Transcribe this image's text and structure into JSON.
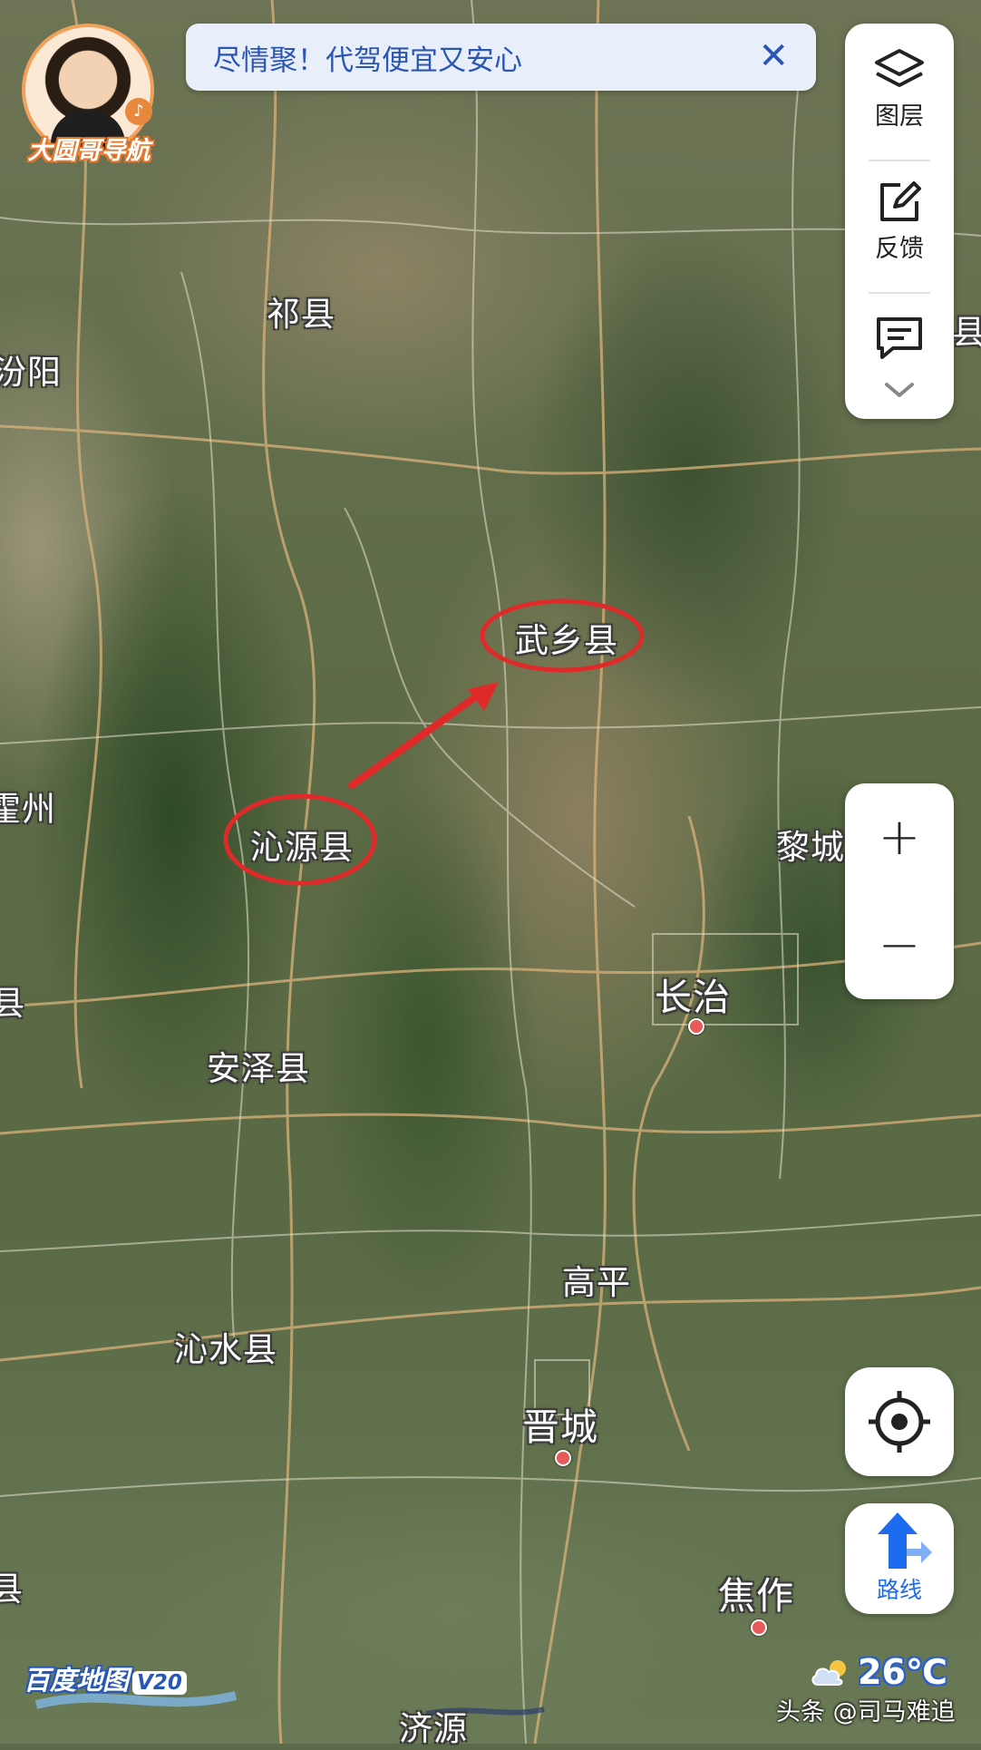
{
  "promo": {
    "text": "尽情聚！代驾便宜又安心",
    "close_symbol": "✕"
  },
  "avatar": {
    "name": "大圆哥导航"
  },
  "tools": {
    "layers_label": "图层",
    "feedback_label": "反馈",
    "message_icon": "message-icon",
    "expand_icon": "chevron-down-icon"
  },
  "zoom": {
    "in_label": "+",
    "out_label": "−"
  },
  "route": {
    "label": "路线"
  },
  "places": {
    "qixian": "祁县",
    "fenyang": "汾阳",
    "wuxiang": "武乡县",
    "huozhou": "霍州",
    "qinyuan": "沁源县",
    "licheng": "黎城",
    "changzhi": "长治",
    "anze": "安泽县",
    "gaoping": "高平",
    "qinshui": "沁水县",
    "jincheng": "晋城",
    "jiaozuo": "焦作",
    "jiyuan": "济源",
    "edge_xian_right_top": "县",
    "edge_xian_left_mid": "县",
    "edge_xian_left_bottom": "县"
  },
  "annotation": {
    "circle_color": "#e02a2a",
    "arrow_color": "#e02a2a",
    "from": "沁源县",
    "to": "武乡县"
  },
  "brand": {
    "logo_text": "百度地图",
    "version": "V20"
  },
  "weather": {
    "temperature": "26℃",
    "icon": "cloud-sun-icon"
  },
  "credit": "头条 @司马难追",
  "colors": {
    "accent": "#1d6cf0",
    "promo_text": "#2a56b8",
    "city_dot": "#e85a5a"
  }
}
